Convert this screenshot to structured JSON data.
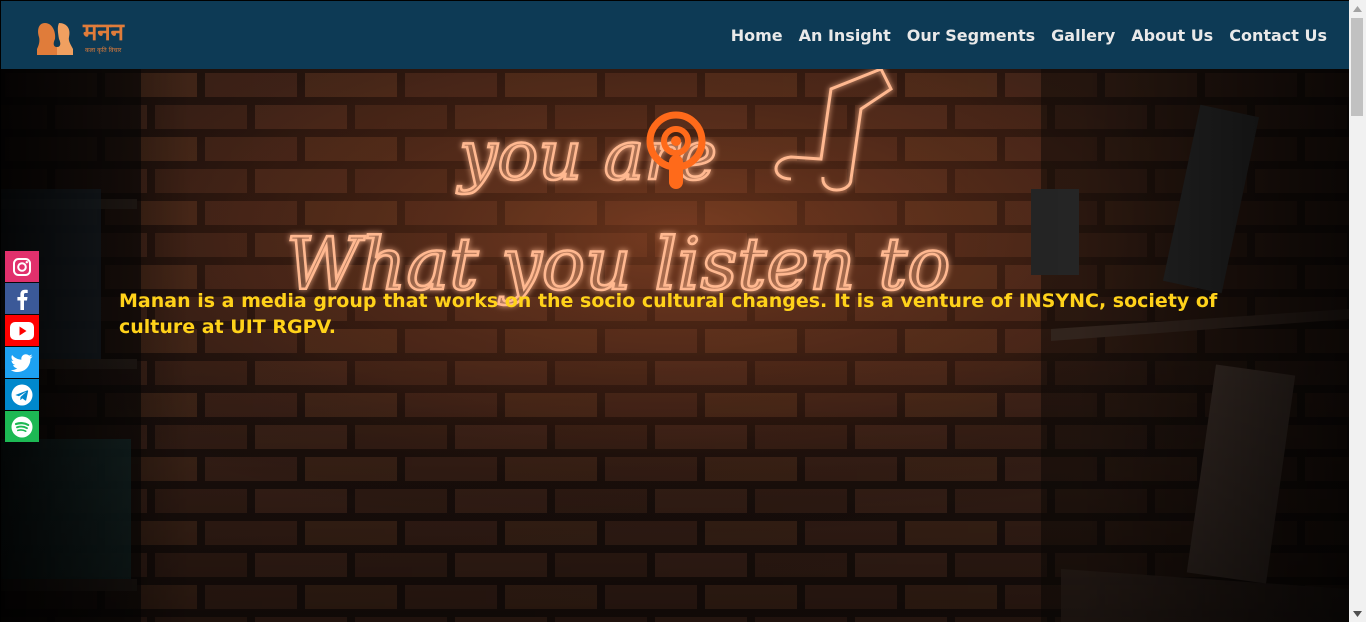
{
  "navbar": {
    "logo": {
      "title": "मनन",
      "subtitle": "कला कृति विचार"
    },
    "links": [
      {
        "label": "Home"
      },
      {
        "label": "An Insight"
      },
      {
        "label": "Our Segments"
      },
      {
        "label": "Gallery"
      },
      {
        "label": "About Us"
      },
      {
        "label": "Contact Us"
      }
    ],
    "background_color": "#0d3a55",
    "link_color": "#e9e9e9"
  },
  "hero": {
    "neon_line_1": "you are",
    "neon_line_2": "What you listen to",
    "tagline": "Manan is a media group that works on the socio cultural changes. It is a venture of INSYNC, society of culture at UIT RGPV.",
    "tagline_color": "#ffd21a",
    "neon_color": "#ffb890"
  },
  "social": [
    {
      "name": "instagram-icon",
      "color": "#e1306c"
    },
    {
      "name": "facebook-icon",
      "color": "#3b5998"
    },
    {
      "name": "youtube-icon",
      "color": "#ff0000"
    },
    {
      "name": "twitter-icon",
      "color": "#1da1f2"
    },
    {
      "name": "telegram-icon",
      "color": "#0088cc"
    },
    {
      "name": "spotify-icon",
      "color": "#1db954"
    }
  ]
}
